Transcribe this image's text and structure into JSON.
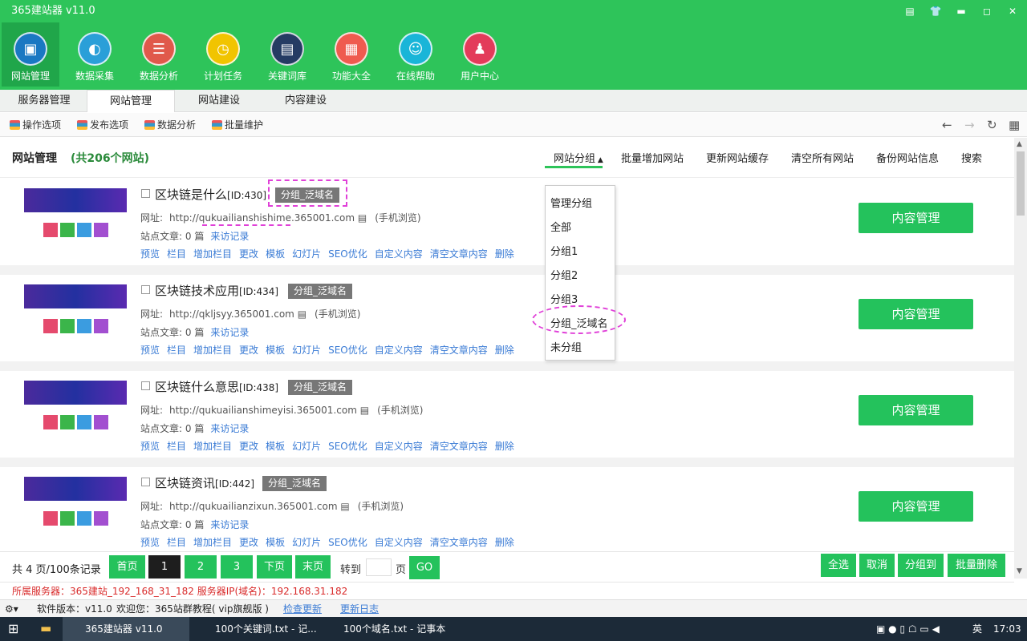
{
  "app": {
    "title": "365建站器 v11.0"
  },
  "window_controls": [
    "▤",
    "👕",
    "▬",
    "◻",
    "✕"
  ],
  "ribbon": [
    {
      "label": "网站管理",
      "icon": "monitor-icon",
      "color": "#1a78c2"
    },
    {
      "label": "数据采集",
      "icon": "edge-icon",
      "color": "#2a9fd8"
    },
    {
      "label": "数据分析",
      "icon": "database-icon",
      "color": "#e0594b"
    },
    {
      "label": "计划任务",
      "icon": "clock-icon",
      "color": "#f1c400"
    },
    {
      "label": "关键词库",
      "icon": "book-icon",
      "color": "#253b63"
    },
    {
      "label": "功能大全",
      "icon": "grid-icon",
      "color": "#ef5b4f"
    },
    {
      "label": "在线帮助",
      "icon": "chat-icon",
      "color": "#19b5d8"
    },
    {
      "label": "用户中心",
      "icon": "user-icon",
      "color": "#e33b5a"
    }
  ],
  "tabs": [
    "服务器管理",
    "网站管理",
    "网站建设",
    "内容建设"
  ],
  "toolbar": [
    "操作选项",
    "发布选项",
    "数据分析",
    "批量维护"
  ],
  "header": {
    "title": "网站管理",
    "count": "(共206个网站)",
    "links": [
      "网站分组",
      "批量增加网站",
      "更新网站缓存",
      "清空所有网站",
      "备份网站信息",
      "搜索"
    ]
  },
  "dropdown": [
    "管理分组",
    "全部",
    "分组1",
    "分组2",
    "分组3",
    "分组_泛域名",
    "未分组"
  ],
  "sites": [
    {
      "name": "区块链是什么",
      "id": "[ID:430]",
      "group": "分组_泛域名",
      "url_label": "网址:",
      "url": "http://qukuailianshishime.365001.com",
      "mobile": "(手机浏览)",
      "stat_label": "站点文章:",
      "stat_value": "0 篇",
      "visits": "来访记录"
    },
    {
      "name": "区块链技术应用",
      "id": "[ID:434]",
      "group": "分组_泛域名",
      "url_label": "网址:",
      "url": "http://qkljsyy.365001.com",
      "mobile": "(手机浏览)",
      "stat_label": "站点文章:",
      "stat_value": "0 篇",
      "visits": "来访记录"
    },
    {
      "name": "区块链什么意思",
      "id": "[ID:438]",
      "group": "分组_泛域名",
      "url_label": "网址:",
      "url": "http://qukuailianshimeyisi.365001.com",
      "mobile": "(手机浏览)",
      "stat_label": "站点文章:",
      "stat_value": "0 篇",
      "visits": "来访记录"
    },
    {
      "name": "区块链资讯",
      "id": "[ID:442]",
      "group": "分组_泛域名",
      "url_label": "网址:",
      "url": "http://qukuailianzixun.365001.com",
      "mobile": "(手机浏览)",
      "stat_label": "站点文章:",
      "stat_value": "0 篇",
      "visits": "来访记录"
    }
  ],
  "actions": [
    "预览",
    "栏目",
    "增加栏目",
    "更改",
    "模板",
    "幻灯片",
    "SEO优化",
    "自定义内容",
    "清空文章内容",
    "删除"
  ],
  "content_button": "内容管理",
  "pager": {
    "info": "共 4 页/100条记录",
    "first": "首页",
    "pages": [
      "1",
      "2",
      "3"
    ],
    "next": "下页",
    "last": "末页",
    "goto": "转到",
    "page_unit": "页",
    "go": "GO",
    "right_buttons": [
      "全选",
      "取消",
      "分组到",
      "批量删除"
    ]
  },
  "server_line": "所属服务器：365建站_192_168_31_182  服务器IP(域名)：192.168.31.182",
  "status": {
    "version": "软件版本：v11.0",
    "welcome": "欢迎您：365站群教程( vip旗舰版 )",
    "check_update": "检查更新",
    "update_log": "更新日志"
  },
  "taskbar": {
    "tasks": [
      "365建站器 v11.0",
      "100个关键词.txt - 记...",
      "100个域名.txt - 记事本"
    ],
    "ime": "英",
    "time": "17:03"
  }
}
